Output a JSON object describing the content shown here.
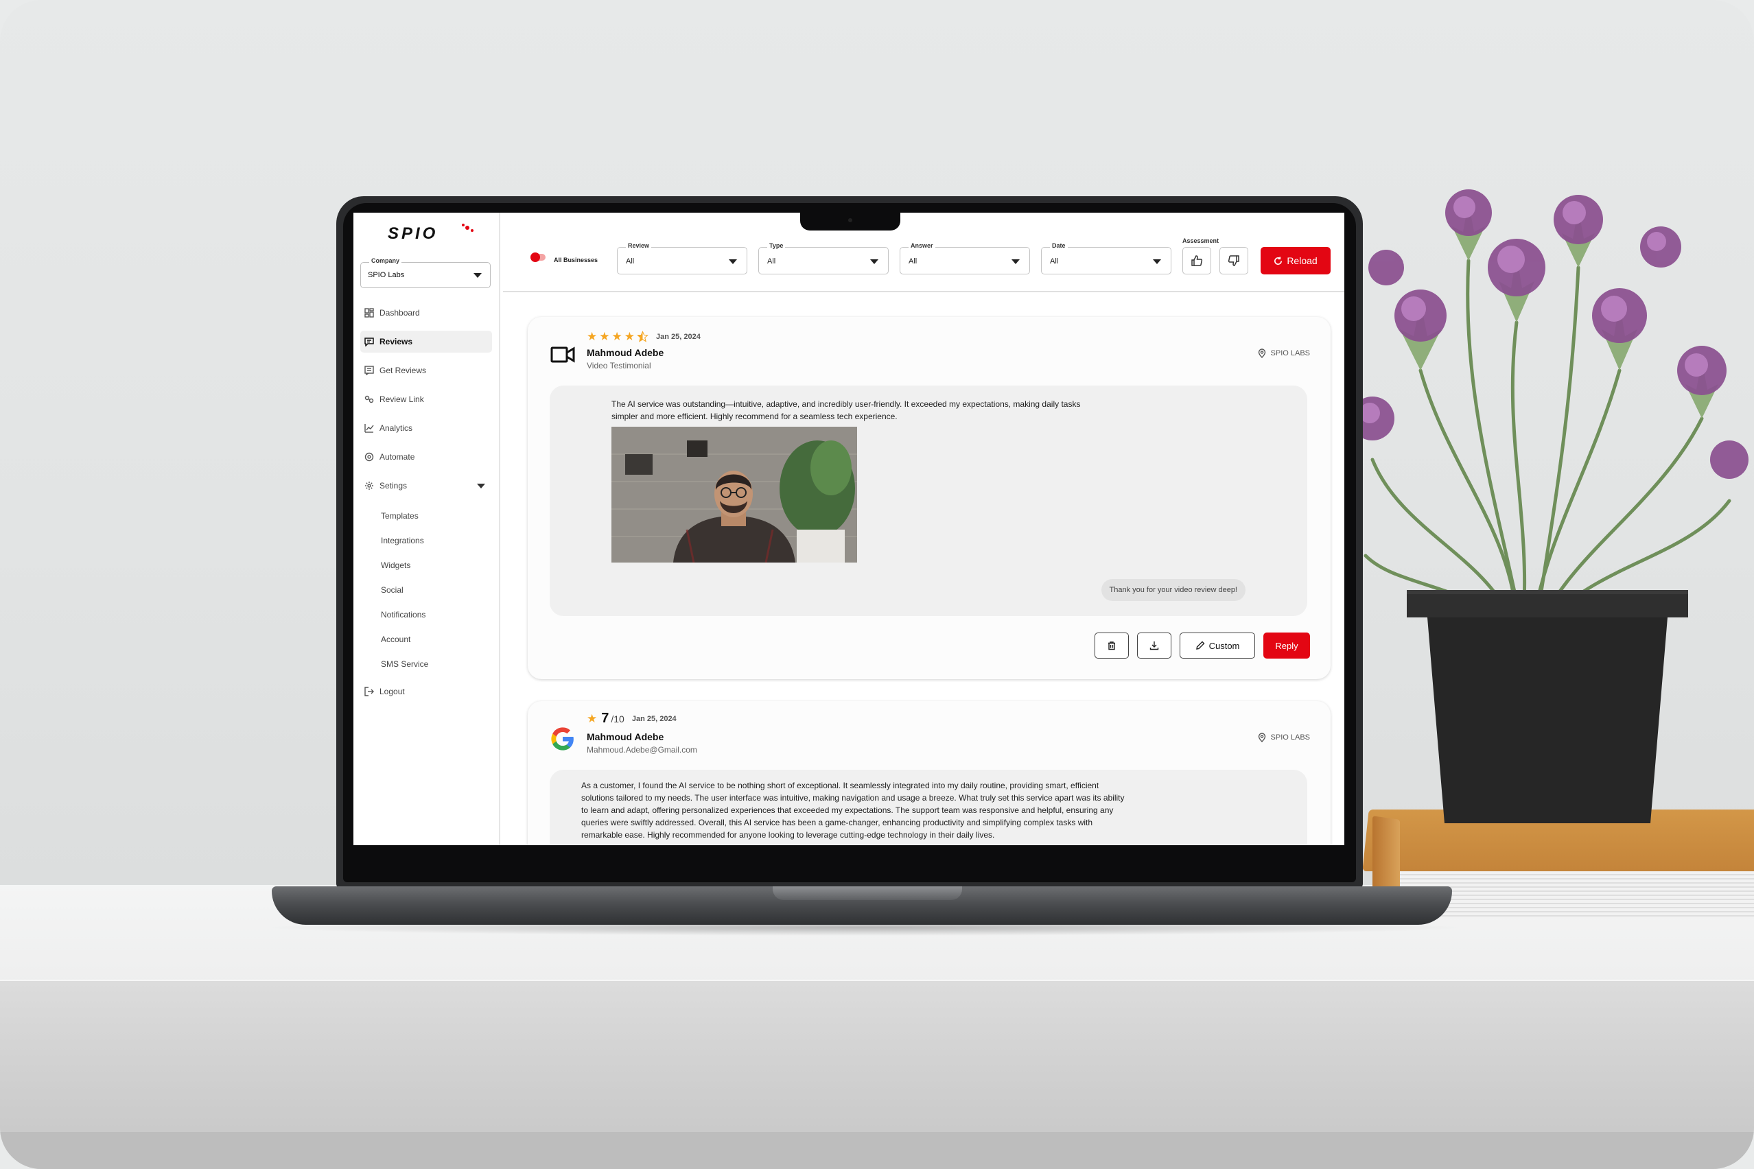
{
  "app": {
    "logo_text": "SPIO"
  },
  "company": {
    "label": "Company",
    "value": "SPIO Labs"
  },
  "nav": {
    "items": [
      {
        "label": "Dashboard",
        "icon": "dashboard-icon"
      },
      {
        "label": "Reviews",
        "icon": "reviews-icon",
        "active": true
      },
      {
        "label": "Get Reviews",
        "icon": "get-reviews-icon"
      },
      {
        "label": "Review Link",
        "icon": "link-icon"
      },
      {
        "label": "Analytics",
        "icon": "analytics-icon"
      },
      {
        "label": "Automate",
        "icon": "automate-icon"
      },
      {
        "label": "Setings",
        "icon": "gear-icon",
        "expanded": true
      }
    ],
    "settings_sub": [
      "Templates",
      "Integrations",
      "Widgets",
      "Social",
      "Notifications",
      "Account",
      "SMS Service"
    ],
    "logout": "Logout"
  },
  "filters": {
    "toggle_label": "All Businesses",
    "review": {
      "label": "Review",
      "value": "All"
    },
    "type": {
      "label": "Type",
      "value": "All"
    },
    "answer": {
      "label": "Answer",
      "value": "All"
    },
    "date": {
      "label": "Date",
      "value": "All"
    },
    "assessment_label": "Assessment",
    "reload_label": "Reload"
  },
  "reviews": [
    {
      "source": "video-camera-icon",
      "stars": 4.5,
      "date": "Jan 25, 2024",
      "name": "Mahmoud Adebe",
      "subtitle": "Video Testimonial",
      "location": "SPIO LABS",
      "text_line1": "The AI service was outstanding—intuitive, adaptive, and incredibly user-friendly. It exceeded my expectations, making daily tasks",
      "text_line2": "simpler and more efficient. Highly recommend for a seamless tech experience.",
      "reply": "Thank you for your video review deep!",
      "actions": {
        "custom": "Custom",
        "reply": "Reply"
      }
    },
    {
      "source": "google-icon",
      "rating": "7",
      "rating_of": "/10",
      "date": "Jan 25, 2024",
      "name": "Mahmoud Adebe",
      "subtitle": "Mahmoud.Adebe@Gmail.com",
      "location": "SPIO LABS",
      "text_line1": "As a customer, I found the AI service to be nothing short of exceptional. It seamlessly integrated into my daily routine, providing smart, efficient",
      "text_line2": "solutions tailored to my needs. The user interface was intuitive, making navigation and usage a breeze. What truly set this service apart was its ability",
      "text_line3": "to learn and adapt, offering personalized experiences that exceeded my expectations. The support team was responsive and helpful, ensuring any",
      "text_line4": "queries were swiftly addressed. Overall, this AI service has been a game-changer, enhancing productivity and simplifying complex tasks with",
      "text_line5": "remarkable ease. Highly recommended for anyone looking to leverage cutting-edge technology in their daily lives."
    }
  ],
  "colors": {
    "accent": "#e30613",
    "star": "#f5a623"
  }
}
